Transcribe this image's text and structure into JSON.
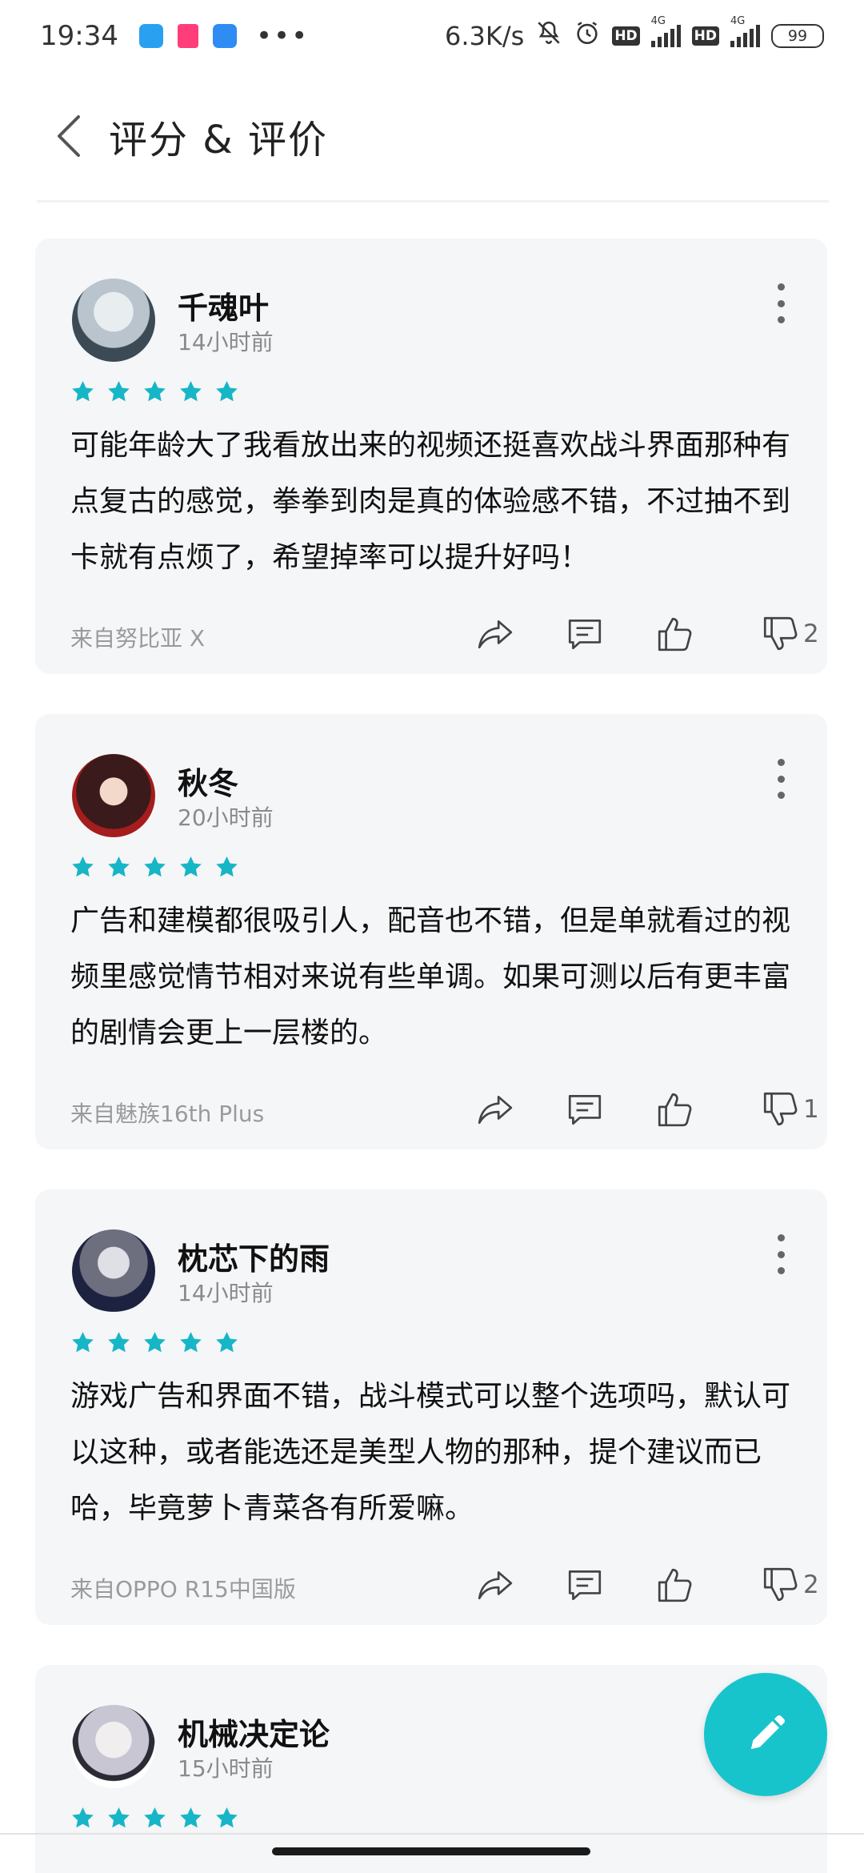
{
  "status_bar": {
    "time": "19:34",
    "dots": "•••",
    "speed": "6.3K/s",
    "hd_1": "HD",
    "hd_2": "HD",
    "network_1": "4G",
    "network_2": "4G",
    "battery": "99",
    "app_icons": [
      "mail-app-icon",
      "video-app-icon",
      "film-app-icon"
    ],
    "icons": [
      "mute-icon",
      "alarm-icon",
      "signal-icon"
    ]
  },
  "header": {
    "title": "评分 & 评价",
    "back_icon": "chevron-left-icon"
  },
  "colors": {
    "accent": "#17c4cc",
    "card_bg": "#f5f6f8",
    "star": "#17b6c6",
    "meta_text": "#8a8a8a"
  },
  "reviews": [
    {
      "user": "千魂叶",
      "time": "14小时前",
      "rating": 5,
      "text": "可能年龄大了我看放出来的视频还挺喜欢战斗界面那种有点复古的感觉，拳拳到肉是真的体验感不错，不过抽不到卡就有点烦了，希望掉率可以提升好吗！",
      "device": "来自努比亚 X",
      "dislikes": "2"
    },
    {
      "user": "秋冬",
      "time": "20小时前",
      "rating": 5,
      "text": "广告和建模都很吸引人，配音也不错，但是单就看过的视频里感觉情节相对来说有些单调。如果可测以后有更丰富的剧情会更上一层楼的。",
      "device": "来自魅族16th Plus",
      "dislikes": "1"
    },
    {
      "user": "枕芯下的雨",
      "time": "14小时前",
      "rating": 5,
      "text": "游戏广告和界面不错，战斗模式可以整个选项吗，默认可以这种，或者能选还是美型人物的那种，提个建议而已哈，毕竟萝卜青菜各有所爱嘛。",
      "device": "来自OPPO R15中国版",
      "dislikes": "2"
    },
    {
      "user": "机械决定论",
      "time": "15小时前",
      "rating": 5
    }
  ],
  "fab": {
    "icon": "pencil-icon"
  }
}
